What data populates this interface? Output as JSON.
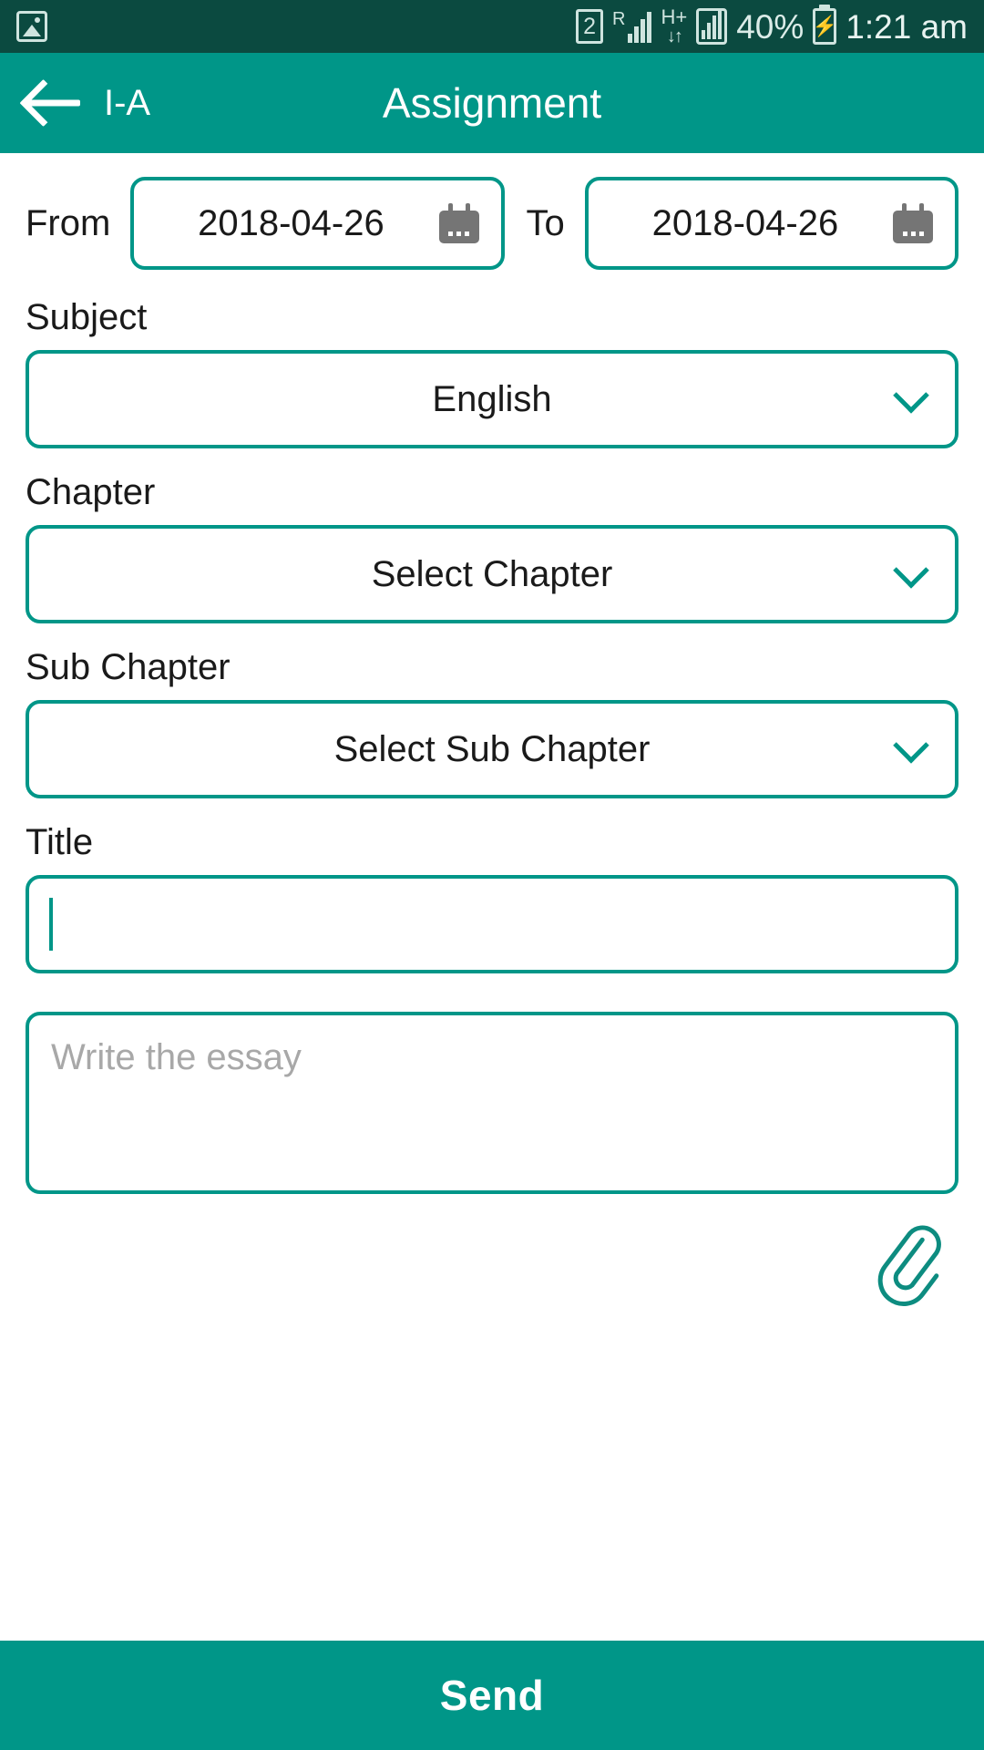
{
  "statusbar": {
    "gallery_icon": "image-icon",
    "sim_badge": "2",
    "roaming": "R",
    "network_type": "H+",
    "battery_percent": "40%",
    "time": "1:21 am"
  },
  "appbar": {
    "back_icon": "back-arrow-icon",
    "class_label": "I-A",
    "title": "Assignment"
  },
  "form": {
    "date_range": {
      "from_label": "From",
      "from_value": "2018-04-26",
      "to_label": "To",
      "to_value": "2018-04-26",
      "calendar_icon": "calendar-icon"
    },
    "subject": {
      "label": "Subject",
      "value": "English"
    },
    "chapter": {
      "label": "Chapter",
      "value": "Select Chapter"
    },
    "sub_chapter": {
      "label": "Sub Chapter",
      "value": "Select Sub Chapter"
    },
    "title": {
      "label": "Title",
      "value": ""
    },
    "essay": {
      "placeholder": "Write the essay",
      "value": ""
    },
    "attachment_icon": "paperclip-icon"
  },
  "footer": {
    "send_label": "Send"
  },
  "colors": {
    "statusbar_bg": "#0b4a40",
    "accent": "#009688",
    "text": "#1a1a1a",
    "placeholder": "#a8a8a8"
  }
}
